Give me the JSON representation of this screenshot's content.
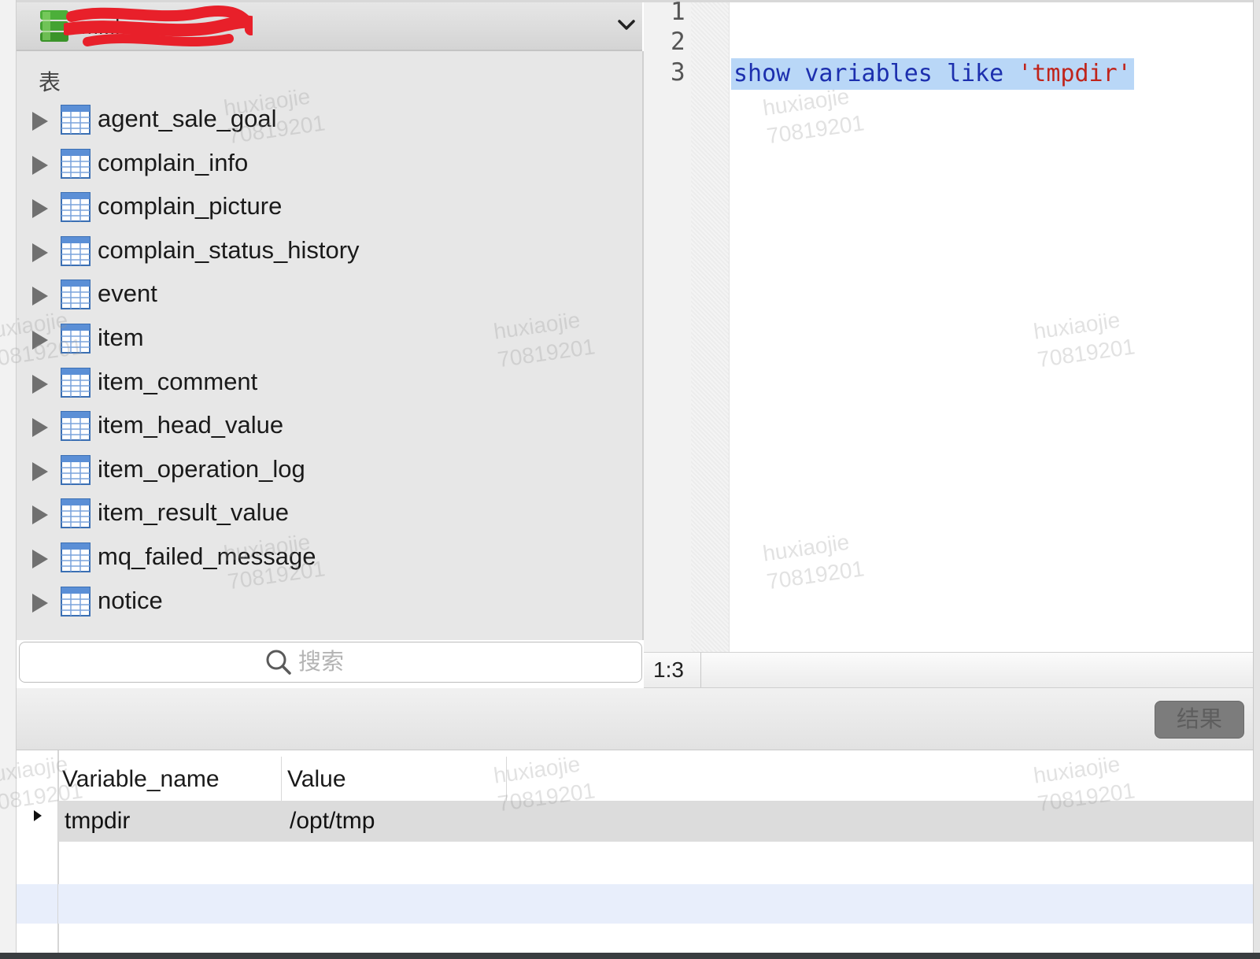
{
  "database": {
    "name": "m...k",
    "name_redacted": true
  },
  "sidebar": {
    "section_label": "表",
    "tables": [
      "agent_sale_goal",
      "complain_info",
      "complain_picture",
      "complain_status_history",
      "event",
      "item",
      "item_comment",
      "item_head_value",
      "item_operation_log",
      "item_result_value",
      "mq_failed_message",
      "notice"
    ],
    "search_placeholder": "搜索"
  },
  "editor": {
    "line_numbers": [
      "1",
      "2",
      "3"
    ],
    "code": {
      "keyword1": "show",
      "keyword2": "variables",
      "keyword3": "like",
      "string": "'tmpdir'"
    },
    "cursor_position": "1:3"
  },
  "results": {
    "button_label": "结果",
    "columns": [
      "Variable_name",
      "Value"
    ],
    "rows": [
      [
        "tmpdir",
        "/opt/tmp"
      ]
    ]
  },
  "watermark": {
    "line1": "huxiaojie",
    "line2": "70819201"
  },
  "colors": {
    "sidebar_bg": "#e7e7e7",
    "selection": "#b9d7f7",
    "keyword": "#1c2fae",
    "string": "#c0241b",
    "redaction": "#e8202a"
  }
}
